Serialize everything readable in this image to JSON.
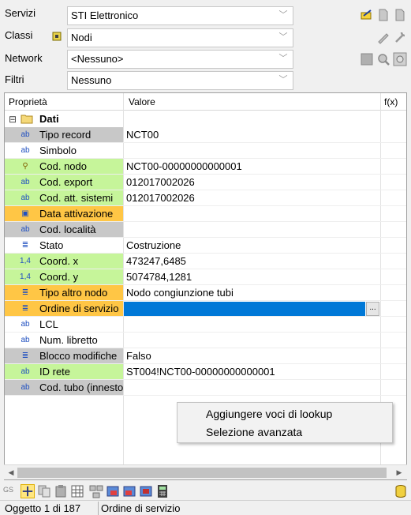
{
  "filters": {
    "servizi_label": "Servizi",
    "servizi_value": "STI Elettronico",
    "classi_label": "Classi",
    "classi_value": "Nodi",
    "network_label": "Network",
    "network_value": "<Nessuno>",
    "filtri_label": "Filtri",
    "filtri_value": "Nessuno"
  },
  "grid": {
    "col_property": "Proprietà",
    "col_value": "Valore",
    "col_fx": "f(x)",
    "group_label": "Dati",
    "group_expander": "⊟",
    "rows": [
      {
        "icon": "ab",
        "label": "Tipo record",
        "value": "NCT00"
      },
      {
        "icon": "ab",
        "label": "Simbolo",
        "value": ""
      },
      {
        "icon": "key",
        "label": "Cod. nodo",
        "value": "NCT00-00000000000001"
      },
      {
        "icon": "ab",
        "label": "Cod. export",
        "value": "012017002026"
      },
      {
        "icon": "ab",
        "label": "Cod. att. sistemi",
        "value": "012017002026"
      },
      {
        "icon": "calendar",
        "label": "Data attivazione",
        "value": ""
      },
      {
        "icon": "ab",
        "label": "Cod. località",
        "value": ""
      },
      {
        "icon": "list",
        "label": "Stato",
        "value": "Costruzione"
      },
      {
        "icon": "1,4",
        "label": "Coord. x",
        "value": "473247,6485"
      },
      {
        "icon": "1,4",
        "label": "Coord. y",
        "value": "5074784,1281"
      },
      {
        "icon": "list",
        "label": "Tipo altro nodo",
        "value": "Nodo congiunzione tubi"
      },
      {
        "icon": "list",
        "label": "Ordine di servizio",
        "value": ""
      },
      {
        "icon": "ab",
        "label": "LCL",
        "value": ""
      },
      {
        "icon": "ab",
        "label": "Num. libretto",
        "value": ""
      },
      {
        "icon": "list",
        "label": "Blocco modifiche",
        "value": "Falso"
      },
      {
        "icon": "ab",
        "label": "ID rete",
        "value": "ST004!NCT00-00000000000001"
      },
      {
        "icon": "ab",
        "label": "Cod. tubo (innesto",
        "value": ""
      }
    ],
    "dot_button": "..."
  },
  "context_menu": {
    "item1": "Aggiungere voci di lookup",
    "item2": "Selezione avanzata"
  },
  "toolbar": {
    "gs_label": "GS"
  },
  "status": {
    "record_counter": "Oggetto 1 di 187",
    "current_field": "Ordine di servizio"
  },
  "colors": {
    "gray_row": "#c8c8c8",
    "green_row": "#c6f59a",
    "orange_row": "#ffc645",
    "selection": "#0078d7"
  }
}
